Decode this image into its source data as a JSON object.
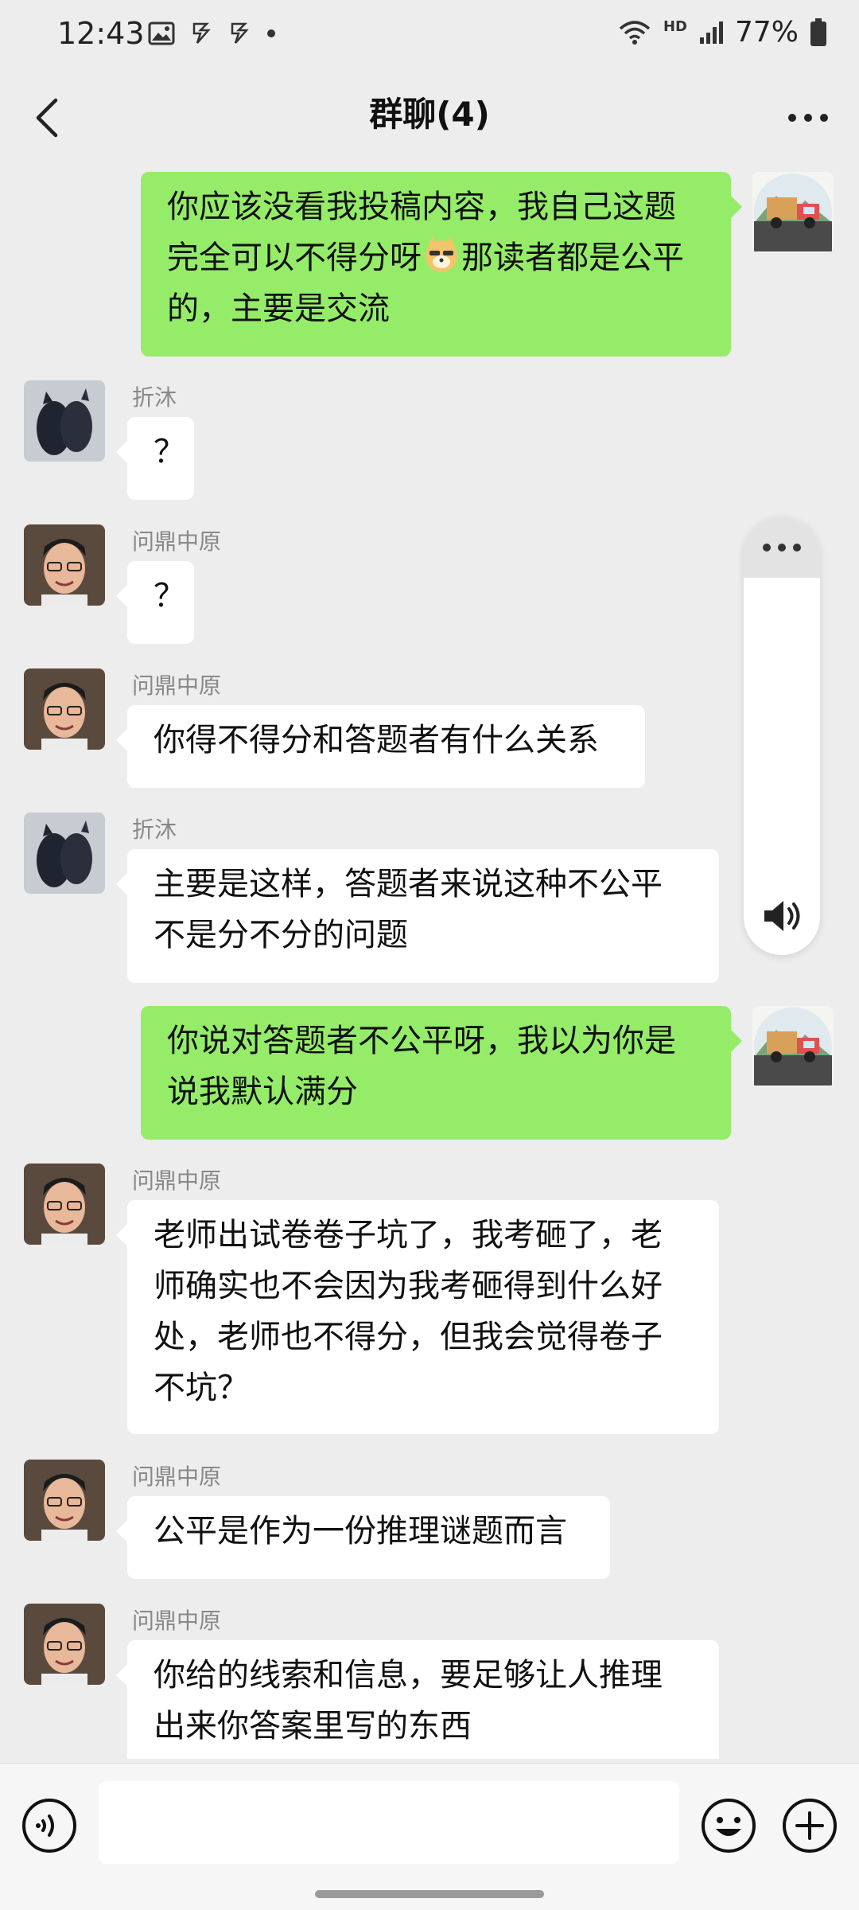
{
  "status_bar": {
    "time": "12:43",
    "battery_pct": "77%",
    "network": "HD",
    "icons": [
      "gallery-icon",
      "app-notification-icon",
      "app-notification-icon",
      "dot-icon",
      "wifi-icon",
      "signal-icon",
      "battery-icon"
    ]
  },
  "header": {
    "title": "群聊(4)"
  },
  "messages": [
    {
      "side": "right",
      "text_before": "你应该没看我投稿内容，我自己这题\n完全可以不得分呀",
      "emoji": "doge-emoji",
      "text_after": "那读者都是公平\n的，主要是交流"
    },
    {
      "side": "left",
      "sender": "折沐",
      "text": "？"
    },
    {
      "side": "left",
      "sender": "问鼎中原",
      "text": "？"
    },
    {
      "side": "left",
      "sender": "问鼎中原",
      "text": "你得不得分和答题者有什么关系"
    },
    {
      "side": "left",
      "sender": "折沐",
      "text": "主要是这样，答题者来说这种不公平\n不是分不分的问题"
    },
    {
      "side": "right",
      "text": "你说对答题者不公平呀，我以为你是\n说我默认满分"
    },
    {
      "side": "left",
      "sender": "问鼎中原",
      "text": "老师出试卷卷子坑了，我考砸了，老\n师确实也不会因为我考砸得到什么好\n处，老师也不得分，但我会觉得卷子\n不坑？"
    },
    {
      "side": "left",
      "sender": "问鼎中原",
      "text": "公平是作为一份推理谜题而言"
    },
    {
      "side": "left",
      "sender": "问鼎中原",
      "text": "你给的线索和信息，要足够让人推理\n出来你答案里写的东西"
    }
  ],
  "input": {
    "value": "",
    "placeholder": ""
  },
  "colors": {
    "background": "#ededed",
    "bubble_self": "#95ec69",
    "bubble_other": "#ffffff"
  }
}
